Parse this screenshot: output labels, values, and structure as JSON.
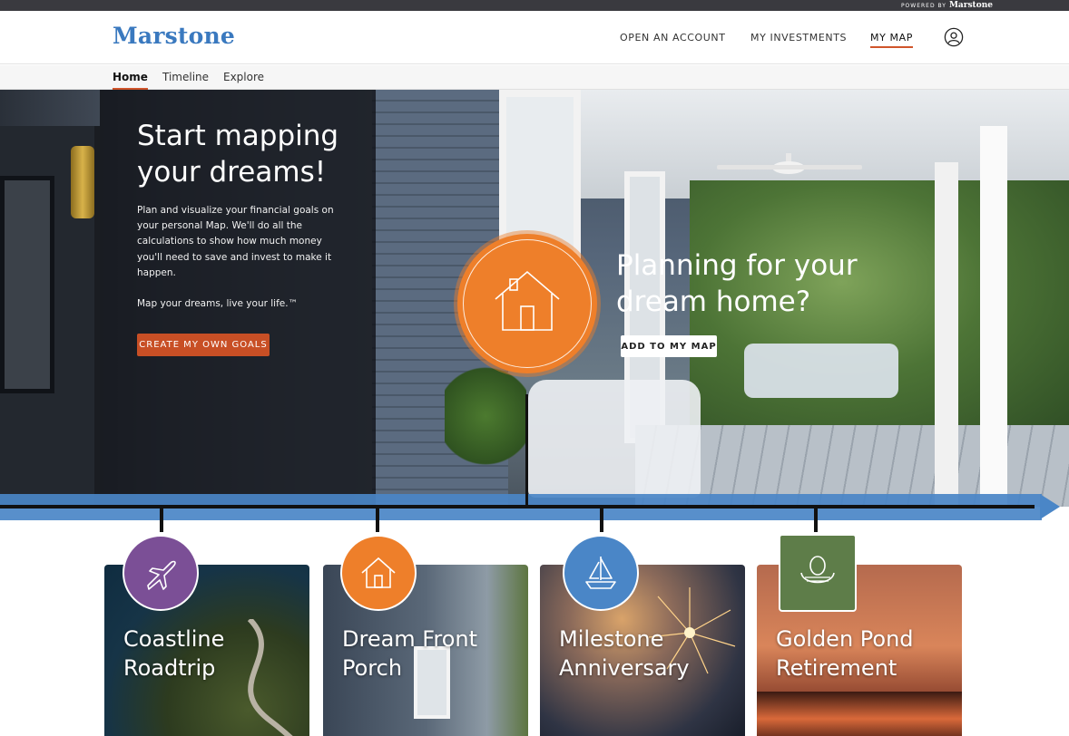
{
  "topbar": {
    "powered_by": "POWERED BY",
    "brand": "Marstone"
  },
  "header": {
    "logo": "Marstone",
    "nav": [
      "OPEN AN ACCOUNT",
      "MY INVESTMENTS",
      "MY MAP"
    ],
    "active_nav": "MY MAP"
  },
  "subnav": {
    "tabs": [
      "Home",
      "Timeline",
      "Explore"
    ],
    "active": "Home"
  },
  "hero": {
    "title": "Start mapping your dreams!",
    "description": "Plan and visualize your financial goals on your personal Map. We'll do all the calculations to show how much money you'll need to save and invest to make it happen.",
    "motto": "Map your dreams, live your life.™",
    "cta_label": "CREATE MY OWN GOALS",
    "feature_title": "Planning for your dream home?",
    "feature_button": "ADD TO MY MAP",
    "feature_icon": "house-icon"
  },
  "goals": [
    {
      "title": "Coastline Roadtrip",
      "icon": "airplane-icon",
      "color": "#7b4f96"
    },
    {
      "title": "Dream Front Porch",
      "icon": "house-icon",
      "color": "#ee7f2a"
    },
    {
      "title": "Milestone Anniversary",
      "icon": "sailboat-icon",
      "color": "#4a86c7"
    },
    {
      "title": "Golden Pond Retirement",
      "icon": "nest-egg-icon",
      "color": "#5e7d49"
    }
  ],
  "colors": {
    "accent": "#c84f25",
    "brand_blue": "#3a79bf",
    "timeline_blue": "#4a86c7"
  }
}
